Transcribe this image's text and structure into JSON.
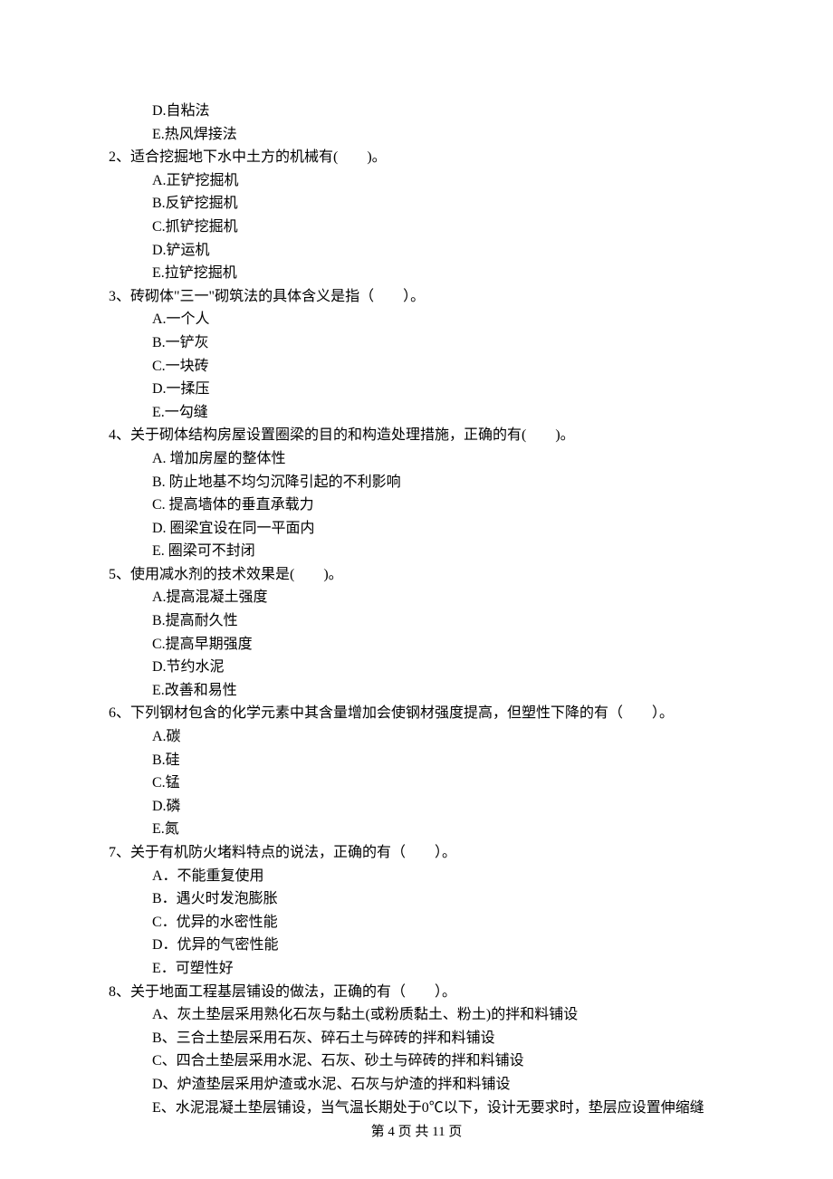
{
  "pre_options": [
    "D.自粘法",
    "E.热风焊接法"
  ],
  "questions": [
    {
      "num": "2、",
      "stem": "适合挖掘地下水中土方的机械有(　　)。",
      "options": [
        "A.正铲挖掘机",
        "B.反铲挖掘机",
        "C.抓铲挖掘机",
        "D.铲运机",
        "E.拉铲挖掘机"
      ]
    },
    {
      "num": "3、",
      "stem": "砖砌体\"三一\"砌筑法的具体含义是指（　　）。",
      "options": [
        "A.一个人",
        "B.一铲灰",
        "C.一块砖",
        "D.一揉压",
        "E.一勾缝"
      ]
    },
    {
      "num": "4、",
      "stem": "关于砌体结构房屋设置圈梁的目的和构造处理措施，正确的有(　　)。",
      "options": [
        "A. 增加房屋的整体性",
        "B. 防止地基不均匀沉降引起的不利影响",
        "C. 提高墙体的垂直承载力",
        "D. 圈梁宜设在同一平面内",
        "E. 圈梁可不封闭"
      ]
    },
    {
      "num": "5、",
      "stem": "使用减水剂的技术效果是(　　)。",
      "options": [
        "A.提高混凝土强度",
        "B.提高耐久性",
        "C.提高早期强度",
        "D.节约水泥",
        "E.改善和易性"
      ]
    },
    {
      "num": "6、",
      "stem": "下列钢材包含的化学元素中其含量增加会使钢材强度提高，但塑性下降的有（　　）。",
      "options": [
        "A.碳",
        "B.硅",
        "C.锰",
        "D.磷",
        "E.氮"
      ]
    },
    {
      "num": "7、",
      "stem": "关于有机防火堵料特点的说法，正确的有（　　）。",
      "options": [
        "A．不能重复使用",
        "B．遇火时发泡膨胀",
        "C．优异的水密性能",
        "D．优异的气密性能",
        "E．可塑性好"
      ]
    },
    {
      "num": "8、",
      "stem": "关于地面工程基层铺设的做法，正确的有（　　）。",
      "options": [
        "A、灰土垫层采用熟化石灰与黏土(或粉质黏土、粉土)的拌和料铺设",
        "B、三合土垫层采用石灰、碎石土与碎砖的拌和料铺设",
        "C、四合土垫层采用水泥、石灰、砂土与碎砖的拌和料铺设",
        "D、炉渣垫层采用炉渣或水泥、石灰与炉渣的拌和料铺设",
        "E、水泥混凝土垫层铺设，当气温长期处于0℃以下，设计无要求时，垫层应设置伸缩缝"
      ]
    }
  ],
  "footer": "第 4 页 共 11 页"
}
